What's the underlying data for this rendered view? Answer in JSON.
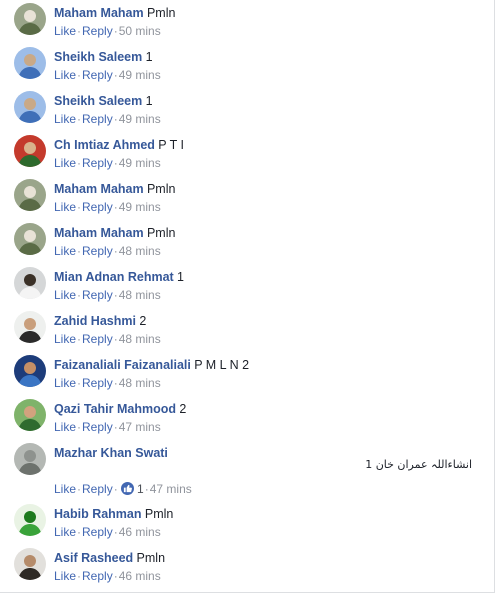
{
  "labels": {
    "like": "Like",
    "reply": "Reply",
    "separator": "·"
  },
  "comments": [
    {
      "author": "Maham Maham",
      "text": "Pmln",
      "time": "50 mins",
      "avatar_icon": "avatar-photo-man-outdoors",
      "avatar_colors": [
        "#9aa58a",
        "#5a6b46",
        "#e8e2d6"
      ]
    },
    {
      "author": "Sheikh Saleem",
      "text": "1",
      "time": "49 mins",
      "avatar_icon": "avatar-photo-man-blue-shirt",
      "avatar_colors": [
        "#9dbde8",
        "#3f6fb8",
        "#c9a987"
      ]
    },
    {
      "author": "Sheikh Saleem",
      "text": "1",
      "time": "49 mins",
      "avatar_icon": "avatar-photo-man-blue-shirt",
      "avatar_colors": [
        "#9dbde8",
        "#3f6fb8",
        "#c9a987"
      ]
    },
    {
      "author": "Ch Imtiaz Ahmed",
      "text": "P T I",
      "time": "49 mins",
      "avatar_icon": "avatar-photo-man-red-background",
      "avatar_colors": [
        "#c43a2c",
        "#2d6a2d",
        "#d9b38c"
      ]
    },
    {
      "author": "Maham Maham",
      "text": "Pmln",
      "time": "49 mins",
      "avatar_icon": "avatar-photo-man-outdoors",
      "avatar_colors": [
        "#9aa58a",
        "#5a6b46",
        "#e8e2d6"
      ]
    },
    {
      "author": "Maham Maham",
      "text": "Pmln",
      "time": "48 mins",
      "avatar_icon": "avatar-photo-man-outdoors",
      "avatar_colors": [
        "#9aa58a",
        "#5a6b46",
        "#e8e2d6"
      ]
    },
    {
      "author": "Mian Adnan Rehmat",
      "text": "1",
      "time": "48 mins",
      "avatar_icon": "avatar-photo-man-white-shirt",
      "avatar_colors": [
        "#d5d7d8",
        "#f4f4f4",
        "#3a3027"
      ]
    },
    {
      "author": "Zahid Hashmi",
      "text": "2",
      "time": "48 mins",
      "avatar_icon": "avatar-photo-man-sunglasses",
      "avatar_colors": [
        "#eef0ee",
        "#2b2b2b",
        "#c99f7c"
      ]
    },
    {
      "author": "Faizanaliali Faizanaliali",
      "text": "P M L N 2",
      "time": "48 mins",
      "avatar_icon": "avatar-photo-man-dark-background",
      "avatar_colors": [
        "#1d3c7a",
        "#3a75c4",
        "#c58f66"
      ]
    },
    {
      "author": "Qazi Tahir Mahmood",
      "text": "2",
      "time": "47 mins",
      "avatar_icon": "avatar-photo-man-green-background",
      "avatar_colors": [
        "#7fb36a",
        "#2f6b2f",
        "#d3a27e"
      ]
    },
    {
      "author": "Mazhar Khan Swati",
      "text": "",
      "time": "47 mins",
      "avatar_icon": "avatar-photo-landscape-gray",
      "avatar_colors": [
        "#b4b8b4",
        "#6d726d",
        "#8e928e"
      ],
      "rtl_text": "انشاءاللہ عمران خان 1",
      "reaction_icon": "thumbs-up-icon",
      "reaction_count": "1"
    },
    {
      "author": "Habib Rahman",
      "text": "Pmln",
      "time": "46 mins",
      "avatar_icon": "avatar-graphic-green-calligraphy",
      "avatar_colors": [
        "#e9f3e4",
        "#3aa33a",
        "#1e7a1e"
      ]
    },
    {
      "author": "Asif Rasheed",
      "text": "Pmln",
      "time": "46 mins",
      "avatar_icon": "avatar-photo-man-portrait",
      "avatar_colors": [
        "#e2e0dc",
        "#2e2a25",
        "#b58b6a"
      ]
    }
  ],
  "theme": {
    "author_color": "#365899",
    "link_color": "#4267b2",
    "time_color": "#90949c",
    "reaction_color": "#4267b2"
  }
}
